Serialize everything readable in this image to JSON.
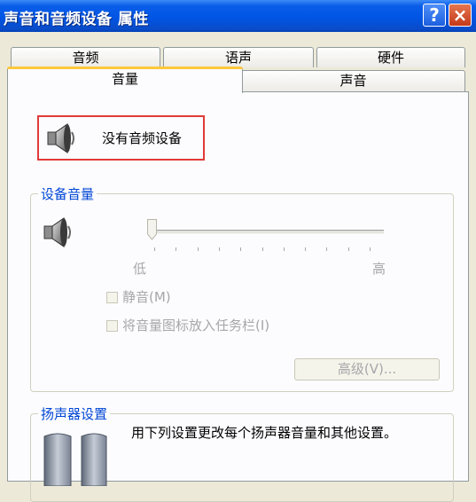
{
  "window": {
    "title": "声音和音频设备 属性",
    "help_label": "?",
    "close_label": "×"
  },
  "tabs": {
    "back_row": [
      "音频",
      "语声",
      "硬件"
    ],
    "front_row": [
      "音量",
      "声音"
    ],
    "selected": "音量"
  },
  "device": {
    "icon": "speaker-icon",
    "label": "没有音频设备"
  },
  "volume_group": {
    "title": "设备音量",
    "slider_level": 0,
    "low_label": "低",
    "high_label": "高",
    "mute_label": "静音(M)",
    "mute_checked": false,
    "tray_label": "将音量图标放入任务栏(I)",
    "tray_checked": false,
    "advanced_button": "高级(V)..."
  },
  "speaker_group": {
    "title": "扬声器设置",
    "description": "用下列设置更改每个扬声器音量和其他设置。"
  },
  "colors": {
    "titlebar": "#0055e5",
    "selected_tab_accent": "#ffc83c",
    "highlight_box": "#e23a3a",
    "group_title": "#0046d5",
    "disabled_text": "#a7a6aa"
  }
}
